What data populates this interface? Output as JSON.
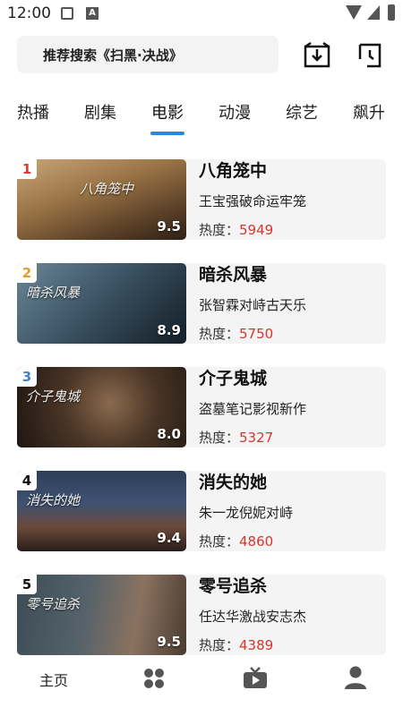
{
  "status": {
    "time": "12:00"
  },
  "search": {
    "placeholder": "推荐搜索《扫黑·决战》"
  },
  "tabs": [
    {
      "label": "热播"
    },
    {
      "label": "剧集"
    },
    {
      "label": "电影"
    },
    {
      "label": "动漫"
    },
    {
      "label": "综艺"
    },
    {
      "label": "飙升"
    }
  ],
  "active_tab": "电影",
  "colors": {
    "accent": "#2f86d6",
    "heat": "#d9342b",
    "rank1": "#e23a2e",
    "rank2": "#e89a2a",
    "rank3": "#3f85c8",
    "rank_other": "#111111"
  },
  "heat_label": "热度：",
  "movies": [
    {
      "rank": "1",
      "title": "八角笼中",
      "desc": "王宝强破命运牢笼",
      "heat": "5949",
      "score": "9.5",
      "poster_title": "八角笼中"
    },
    {
      "rank": "2",
      "title": "暗杀风暴",
      "desc": "张智霖对峙古天乐",
      "heat": "5750",
      "score": "8.9",
      "poster_title": "暗杀风暴"
    },
    {
      "rank": "3",
      "title": "介子鬼城",
      "desc": "盗墓笔记影视新作",
      "heat": "5327",
      "score": "8.0",
      "poster_title": "介子鬼城"
    },
    {
      "rank": "4",
      "title": "消失的她",
      "desc": "朱一龙倪妮对峙",
      "heat": "4860",
      "score": "9.4",
      "poster_title": "消失的她"
    },
    {
      "rank": "5",
      "title": "零号追杀",
      "desc": "任达华激战安志杰",
      "heat": "4389",
      "score": "9.5",
      "poster_title": "零号追杀"
    }
  ],
  "nav": {
    "home": "主页"
  },
  "icons": [
    "download-icon",
    "history-icon",
    "grid-icon",
    "tv-icon",
    "user-icon"
  ]
}
